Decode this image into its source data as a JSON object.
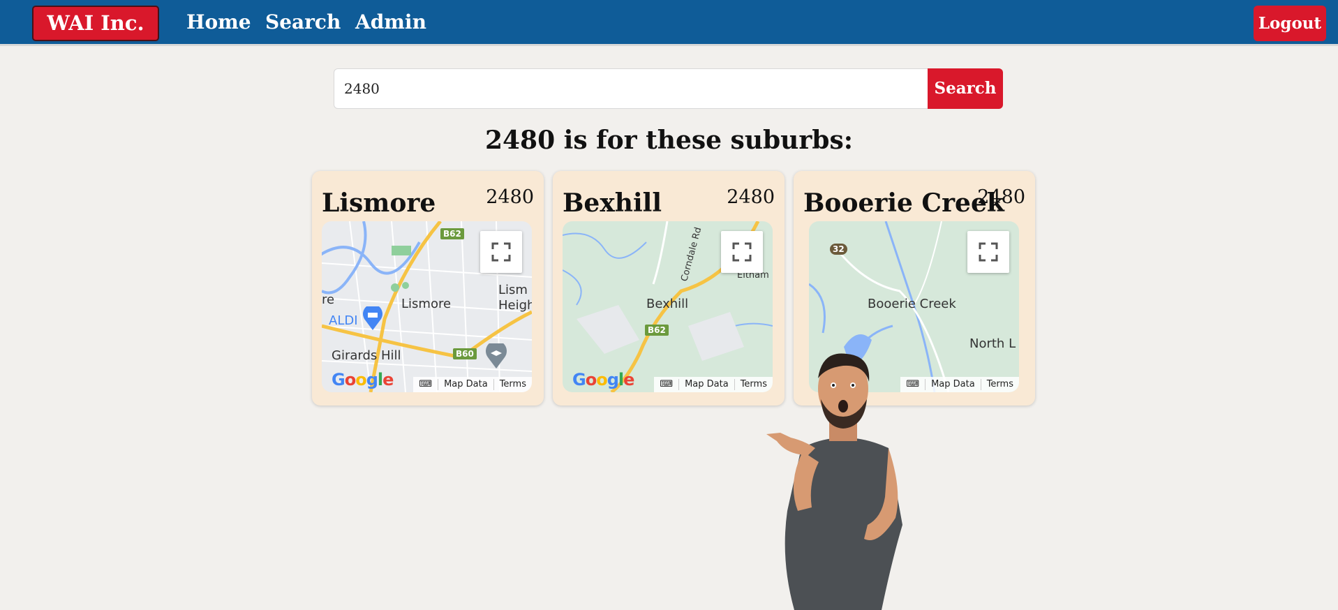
{
  "navbar": {
    "brand": "WAI Inc.",
    "links": [
      "Home",
      "Search",
      "Admin"
    ],
    "logout_label": "Logout"
  },
  "search": {
    "value": "2480",
    "button_label": "Search"
  },
  "results": {
    "heading": "2480 is for these suburbs:",
    "suburbs": [
      {
        "name": "Lismore",
        "postcode": "2480",
        "map_labels": [
          "Lismore",
          "Lism",
          "Heigh",
          "ALDI",
          "Girards Hill",
          "re"
        ],
        "road_shields": [
          "B62",
          "B60"
        ]
      },
      {
        "name": "Bexhill",
        "postcode": "2480",
        "map_labels": [
          "Bexhill",
          "Corndale Rd",
          "Eltham"
        ],
        "road_shields": [
          "B62"
        ]
      },
      {
        "name": "Booerie Creek",
        "postcode": "2480",
        "map_labels": [
          "Booerie Creek",
          "North L"
        ],
        "road_shields": [
          "32"
        ]
      }
    ],
    "map_attribution": {
      "map_data": "Map Data",
      "terms": "Terms",
      "logo": "Google"
    }
  },
  "colors": {
    "navbar": "#0f5c98",
    "accent_red": "#d9182b",
    "card_bg": "#f9e9d5",
    "page_bg": "#f2f0ed"
  },
  "icons": [
    "fullscreen-icon",
    "keyboard-icon",
    "shopping-cart-icon",
    "graduation-cap-icon"
  ]
}
